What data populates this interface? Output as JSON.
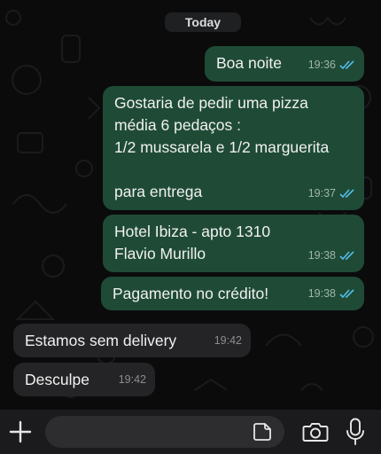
{
  "date_separator": "Today",
  "messages": [
    {
      "text": "Boa noite",
      "time": "19:36"
    },
    {
      "text": "Gostaria de pedir uma pizza\nmédia 6 pedaços :\n1/2 mussarela e 1/2 marguerita\n\npara entrega",
      "time": "19:37"
    },
    {
      "text": "Hotel Ibiza - apto 1310\nFlavio Murillo",
      "time": "19:38"
    },
    {
      "text": "Pagamento no crédito!",
      "time": "19:38"
    },
    {
      "text": "Estamos sem delivery",
      "time": "19:42"
    },
    {
      "text": "Desculpe",
      "time": "19:42"
    }
  ],
  "composer": {
    "input_value": "",
    "icons": [
      "plus-icon",
      "sticker-icon",
      "camera-icon",
      "microphone-icon"
    ]
  },
  "colors": {
    "outgoing_bubble": "#1f4b36",
    "incoming_bubble": "#242426",
    "read_ticks": "#53bdeb",
    "background": "#0b0b0c"
  }
}
